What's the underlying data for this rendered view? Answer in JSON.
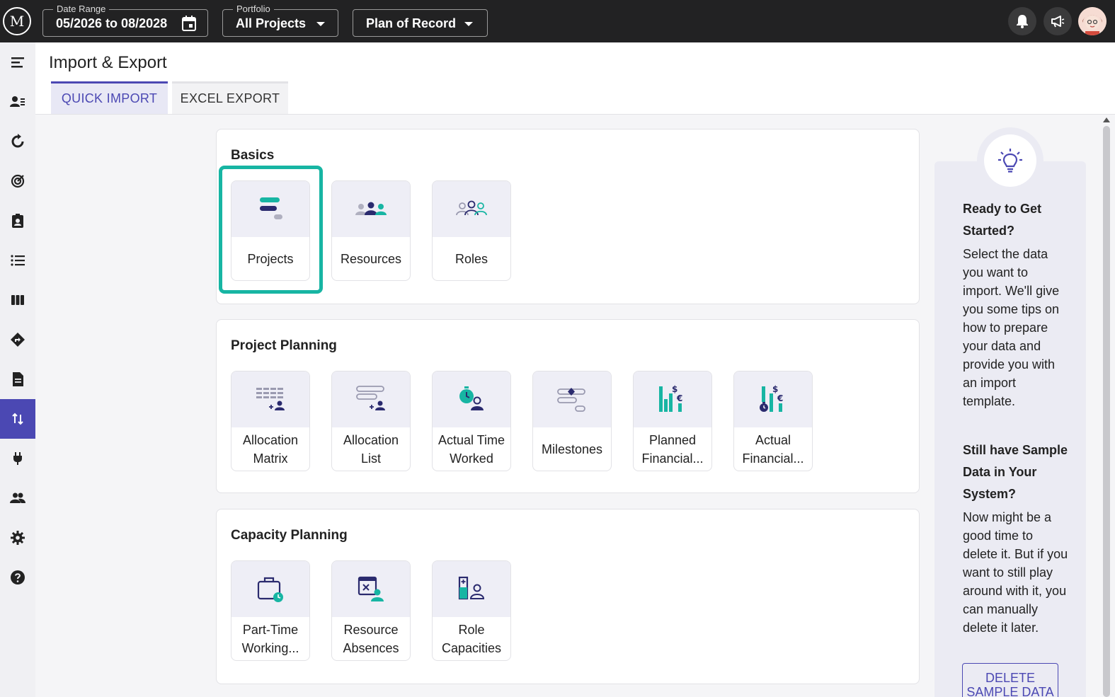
{
  "topbar": {
    "logo": "M",
    "date_range": {
      "label": "Date Range",
      "value": "05/2026 to 08/2028"
    },
    "portfolio": {
      "label": "Portfolio",
      "value": "All Projects"
    },
    "plan": {
      "value": "Plan of Record"
    }
  },
  "sidebar": {
    "items": [
      {
        "icon": "menu-icon"
      },
      {
        "icon": "resources-icon"
      },
      {
        "icon": "refresh-icon"
      },
      {
        "icon": "target-icon"
      },
      {
        "icon": "badge-icon"
      },
      {
        "icon": "list-icon"
      },
      {
        "icon": "columns-icon"
      },
      {
        "icon": "directions-icon"
      },
      {
        "icon": "document-icon"
      },
      {
        "icon": "import-export-icon",
        "active": true
      },
      {
        "icon": "plug-icon"
      },
      {
        "icon": "people-icon"
      },
      {
        "icon": "gear-icon"
      },
      {
        "icon": "help-icon"
      }
    ]
  },
  "header": {
    "title": "Import & Export",
    "tabs": [
      {
        "label": "QUICK IMPORT",
        "active": true
      },
      {
        "label": "EXCEL EXPORT",
        "active": false
      }
    ]
  },
  "sections": {
    "basics": {
      "title": "Basics",
      "tiles": [
        "Projects",
        "Resources",
        "Roles"
      ]
    },
    "project_planning": {
      "title": "Project Planning",
      "tiles": [
        "Allocation Matrix",
        "Allocation List",
        "Actual Time Worked",
        "Milestones",
        "Planned Financial...",
        "Actual Financial..."
      ]
    },
    "capacity_planning": {
      "title": "Capacity Planning",
      "tiles": [
        "Part-Time Working...",
        "Resource Absences",
        "Role Capacities"
      ]
    }
  },
  "help": {
    "heading1": "Ready to Get Started?",
    "text1": "Select the data you want to import. We'll give you some tips on how to prepare your data and provide you with an import template.",
    "heading2": "Still have Sample Data in Your System?",
    "text2": "Now might be a good time to delete it. But if you want to still play around with it, you can manually delete it later.",
    "button": "DELETE SAMPLE DATA"
  },
  "colors": {
    "accent": "#4b48b3",
    "teal": "#17b5a3",
    "navy": "#2a2a6e",
    "topbar": "#222223"
  }
}
